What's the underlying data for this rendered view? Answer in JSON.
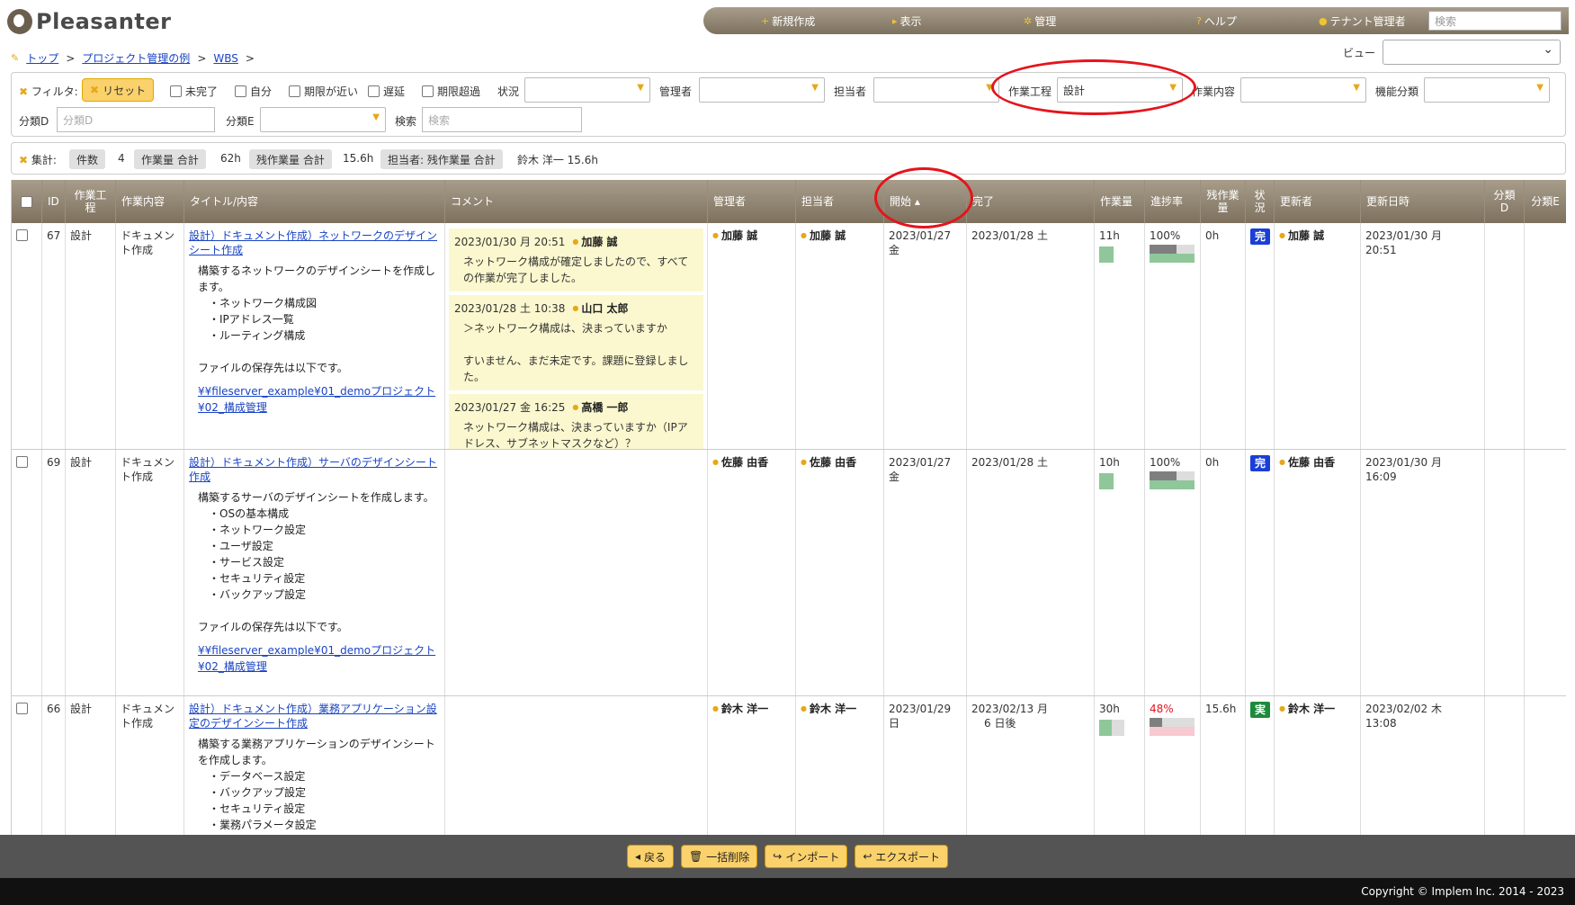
{
  "app": {
    "name": "Pleasanter"
  },
  "nav": {
    "items": [
      {
        "icon": "+",
        "label": "新規作成"
      },
      {
        "icon": "▸",
        "label": "表示"
      },
      {
        "icon": "✲",
        "label": "管理"
      },
      {
        "icon": "?",
        "label": "ヘルプ"
      },
      {
        "icon": "●",
        "label": "テナント管理者"
      }
    ],
    "search_placeholder": "検索"
  },
  "breadcrumb": [
    "トップ",
    "プロジェクト管理の例",
    "WBS"
  ],
  "view": {
    "label": "ビュー",
    "value": ""
  },
  "filter": {
    "title": "フィルタ:",
    "reset_label": "リセット",
    "checkboxes": [
      "未完了",
      "自分",
      "期限が近い",
      "遅延",
      "期限超過"
    ],
    "status_label": "状況",
    "manager_label": "管理者",
    "assignee_label": "担当者",
    "process_label": "作業工程",
    "process_value": "設計",
    "work_label": "作業内容",
    "func_label": "機能分類",
    "classD_label": "分類D",
    "classD_placeholder": "分類D",
    "classE_label": "分類E",
    "search_label": "検索",
    "search_placeholder": "検索"
  },
  "aggregate": {
    "title": "集計:",
    "items": [
      {
        "label": "件数",
        "value": "4"
      },
      {
        "label": "作業量 合計",
        "value": "62h"
      },
      {
        "label": "残作業量 合計",
        "value": "15.6h"
      },
      {
        "label": "担当者: 残作業量 合計",
        "value": "鈴木 洋一 15.6h"
      }
    ]
  },
  "columns": [
    "ID",
    "作業工程",
    "作業内容",
    "タイトル/内容",
    "コメント",
    "管理者",
    "担当者",
    "開始 ▴",
    "完了",
    "作業量",
    "進捗率",
    "残作業量",
    "状況",
    "更新者",
    "更新日時",
    "分類D",
    "分類E"
  ],
  "rows": [
    {
      "id": "67",
      "process": "設計",
      "work": "ドキュメント作成",
      "title": "設計）ドキュメント作成）ネットワークのデザインシート作成",
      "body": "構築するネットワークのデザインシートを作成します。\n　・ネットワーク構成図\n　・IPアドレス一覧\n　・ルーティング構成\n\nファイルの保存先は以下です。",
      "link": "¥¥fileserver_example¥01_demoプロジェクト¥02_構成管理",
      "comments": [
        {
          "date": "2023/01/30 月 20:51",
          "user": "加藤 誠",
          "text": "ネットワーク構成が確定しましたので、すべての作業が完了しました。"
        },
        {
          "date": "2023/01/28 土 10:38",
          "user": "山口 太郎",
          "text": "＞ネットワーク構成は、決まっていますか\n\nすいません、まだ未定です。課題に登録しました。"
        },
        {
          "date": "2023/01/27 金 16:25",
          "user": "高橋 一郎",
          "text": "ネットワーク構成は、決まっていますか（IPアドレス、サブネットマスクなど）？"
        }
      ],
      "manager": "加藤 誠",
      "assignee": "加藤 誠",
      "start": "2023/01/27 金",
      "end": "2023/01/28 土",
      "end_note": "",
      "work_amount": "11h",
      "work_fill": 1.0,
      "progress": "100%",
      "progress_value": 100,
      "progress_color": "#333333",
      "remaining": "0h",
      "status": "完",
      "status_color": "#1a3fd6",
      "updater": "加藤 誠",
      "updated": "2023/01/30 月\n20:51"
    },
    {
      "id": "69",
      "process": "設計",
      "work": "ドキュメント作成",
      "title": "設計）ドキュメント作成）サーバのデザインシート作成",
      "body": "構築するサーバのデザインシートを作成します。\n　・OSの基本構成\n　・ネットワーク設定\n　・ユーザ設定\n　・サービス設定\n　・セキュリティ設定\n　・バックアップ設定\n\nファイルの保存先は以下です。",
      "link": "¥¥fileserver_example¥01_demoプロジェクト¥02_構成管理",
      "comments": [],
      "manager": "佐藤 由香",
      "assignee": "佐藤 由香",
      "start": "2023/01/27 金",
      "end": "2023/01/28 土",
      "end_note": "",
      "work_amount": "10h",
      "work_fill": 1.0,
      "progress": "100%",
      "progress_value": 100,
      "progress_color": "#333333",
      "remaining": "0h",
      "status": "完",
      "status_color": "#1a3fd6",
      "updater": "佐藤 由香",
      "updated": "2023/01/30 月\n16:09"
    },
    {
      "id": "66",
      "process": "設計",
      "work": "ドキュメント作成",
      "title": "設計）ドキュメント作成）業務アプリケーション設定のデザインシート作成",
      "body": "構築する業務アプリケーションのデザインシートを作成します。\n　・データベース設定\n　・バックアップ設定\n　・セキュリティ設定\n　・業務パラメータ設定\n\nファイルの保存先は以下です。",
      "link": "",
      "comments": [],
      "manager": "鈴木 洋一",
      "assignee": "鈴木 洋一",
      "start": "2023/01/29 日",
      "end": "2023/02/13 月",
      "end_note": "6 日後",
      "work_amount": "30h",
      "work_fill": 0.5,
      "progress": "48%",
      "progress_value": 48,
      "progress_color": "#e4141c",
      "remaining": "15.6h",
      "status": "実",
      "status_color": "#1e8a3c",
      "updater": "鈴木 洋一",
      "updated": "2023/02/02 木\n13:08"
    }
  ],
  "toolbar": [
    {
      "icon": "◂",
      "label": "戻る"
    },
    {
      "icon": "🗑",
      "label": "一括削除"
    },
    {
      "icon": "↪",
      "label": "インポート"
    },
    {
      "icon": "↩",
      "label": "エクスポート"
    }
  ],
  "footer": {
    "copyright": "Copyright © Implem Inc. 2014 - 2023"
  },
  "colors": {
    "accent": "#fad16b",
    "header": "#8e8270",
    "annotation": "#e4141c"
  }
}
